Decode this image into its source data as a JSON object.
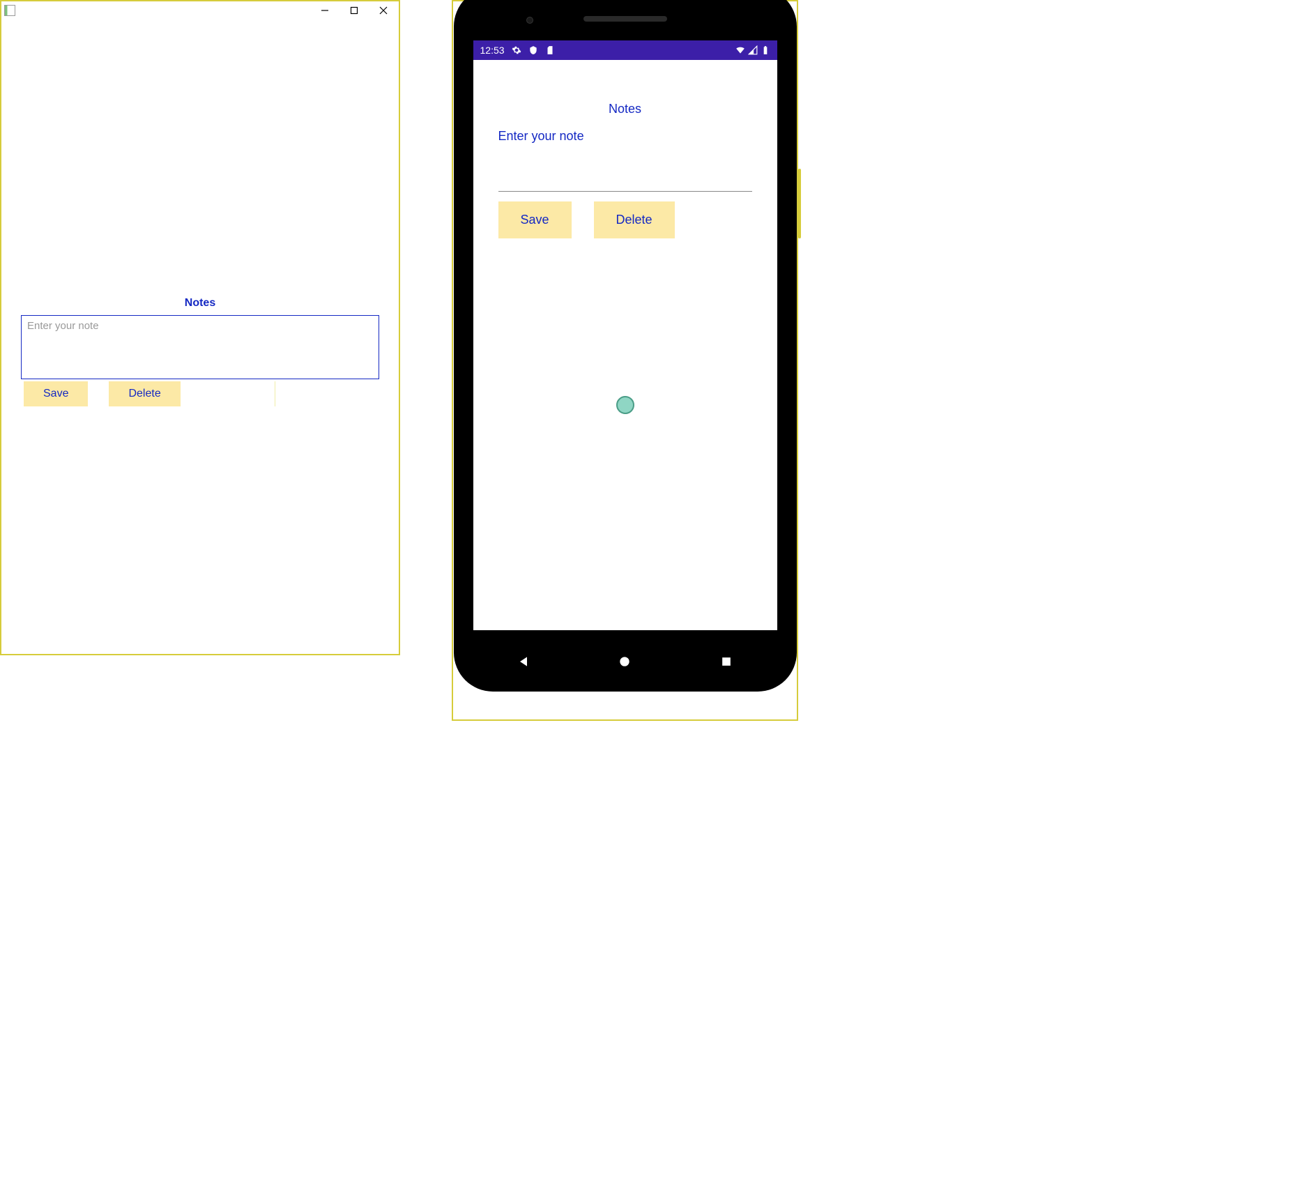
{
  "desktop": {
    "title": "Notes",
    "placeholder": "Enter your note",
    "save_label": "Save",
    "delete_label": "Delete"
  },
  "phone": {
    "status_time": "12:53",
    "title": "Notes",
    "placeholder": "Enter your note",
    "save_label": "Save",
    "delete_label": "Delete"
  }
}
